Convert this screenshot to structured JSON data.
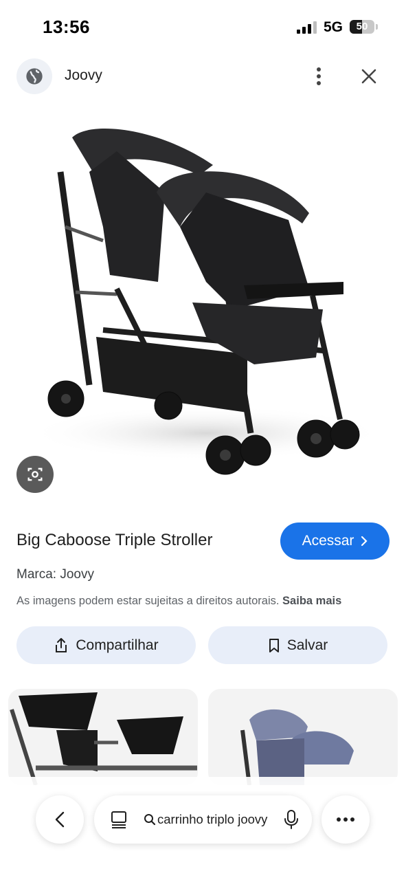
{
  "status_bar": {
    "time": "13:56",
    "network": "5G",
    "battery": "50",
    "battery_level": 0.5
  },
  "header": {
    "site_name": "Joovy",
    "site_icon": "globe-icon",
    "menu_icon": "kebab-menu-icon",
    "close_icon": "close-icon"
  },
  "product": {
    "title": "Big Caboose Triple Stroller",
    "visit_label": "Acessar",
    "brand_line": "Marca: Joovy",
    "copyright_text": "As imagens podem estar sujeitas a direitos autorais.",
    "learn_more": "Saiba mais",
    "share_label": "Compartilhar",
    "save_label": "Salvar"
  },
  "bottom_bar": {
    "search_query": "carrinho triplo joovy"
  },
  "colors": {
    "accent": "#1a73e8",
    "pill_bg": "#e8eef9",
    "lens_bg": "#5a5a5a"
  }
}
